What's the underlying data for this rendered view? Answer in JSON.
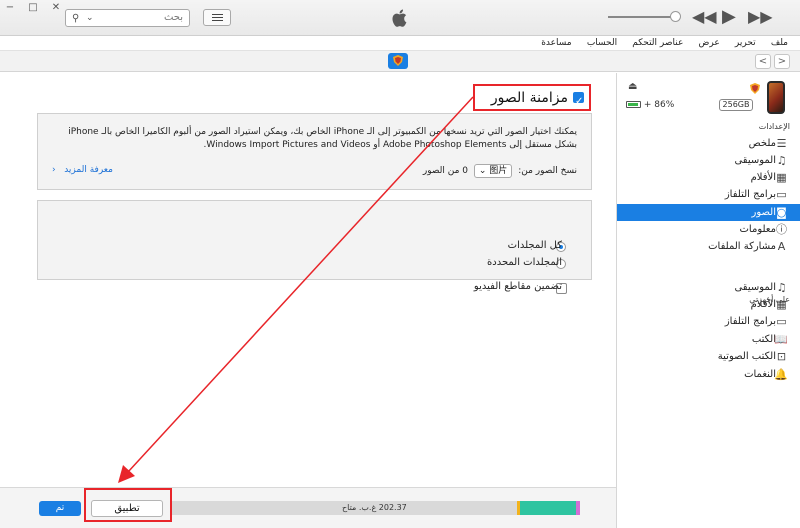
{
  "toolbar": {
    "search_placeholder": "بحث",
    "window_minimize": "−",
    "window_maximize": "□",
    "window_close": "✕"
  },
  "menu": [
    "ملف",
    "تحرير",
    "عرض",
    "عناصر التحكم",
    "الحساب",
    "مساعدة"
  ],
  "device": {
    "capacity": "256GB",
    "battery": "86%"
  },
  "sidebar": {
    "settings_title": "الإعدادات",
    "settings_items": [
      {
        "label": "ملخص",
        "icon": "summary-icon",
        "selected": false
      },
      {
        "label": "الموسيقى",
        "icon": "music-note-icon",
        "selected": false
      },
      {
        "label": "الأفلام",
        "icon": "film-icon",
        "selected": false
      },
      {
        "label": "برامج التلفاز",
        "icon": "tv-icon",
        "selected": false
      },
      {
        "label": "الصور",
        "icon": "camera-icon",
        "selected": true
      },
      {
        "label": "معلومات",
        "icon": "info-icon",
        "selected": false
      },
      {
        "label": "مشاركة الملفات",
        "icon": "apps-icon",
        "selected": false
      }
    ],
    "ondevice_title": "على أجهزتي",
    "ondevice_items": [
      {
        "label": "الموسيقى",
        "icon": "music-note-icon"
      },
      {
        "label": "الأفلام",
        "icon": "film-icon"
      },
      {
        "label": "برامج التلفاز",
        "icon": "tv-icon"
      },
      {
        "label": "الكتب",
        "icon": "book-icon"
      },
      {
        "label": "الكتب الصوتية",
        "icon": "audiobook-icon"
      },
      {
        "label": "النغمات",
        "icon": "bell-icon"
      }
    ]
  },
  "main": {
    "sync_title": "مزامنة الصور",
    "sync_checked": true,
    "description": "يمكنك اختيار الصور التي تريد نسخها من الكمبيوتر إلى الـ iPhone الخاص بك، ويمكن استيراد الصور من ألبوم الكاميرا الخاص بالـ iPhone بشكل مستقل إلى Adobe Photoshop Elements أو Windows Import Pictures and Videos.",
    "copy_from_label": "نسخ الصور من:",
    "copy_from_value": "图片",
    "photo_count": "0 من الصور",
    "learn_more": "معرفة المزيد",
    "options": {
      "all_folders": "كل المجلدات",
      "selected_folders": "المجلدات المحددة",
      "include_videos": "تضمين مقاطع الفيديو"
    }
  },
  "bottom": {
    "free_space": "202.37 غ.ب. متاح",
    "apply": "تطبيق",
    "done": "تم"
  },
  "colors": {
    "accent": "#1a7fe3",
    "annotation": "#e8252a",
    "storage_teal": "#2ec4a0",
    "storage_yellow": "#f2b31c",
    "storage_pink": "#d36fd6",
    "storage_free": "#d9d9d9"
  }
}
